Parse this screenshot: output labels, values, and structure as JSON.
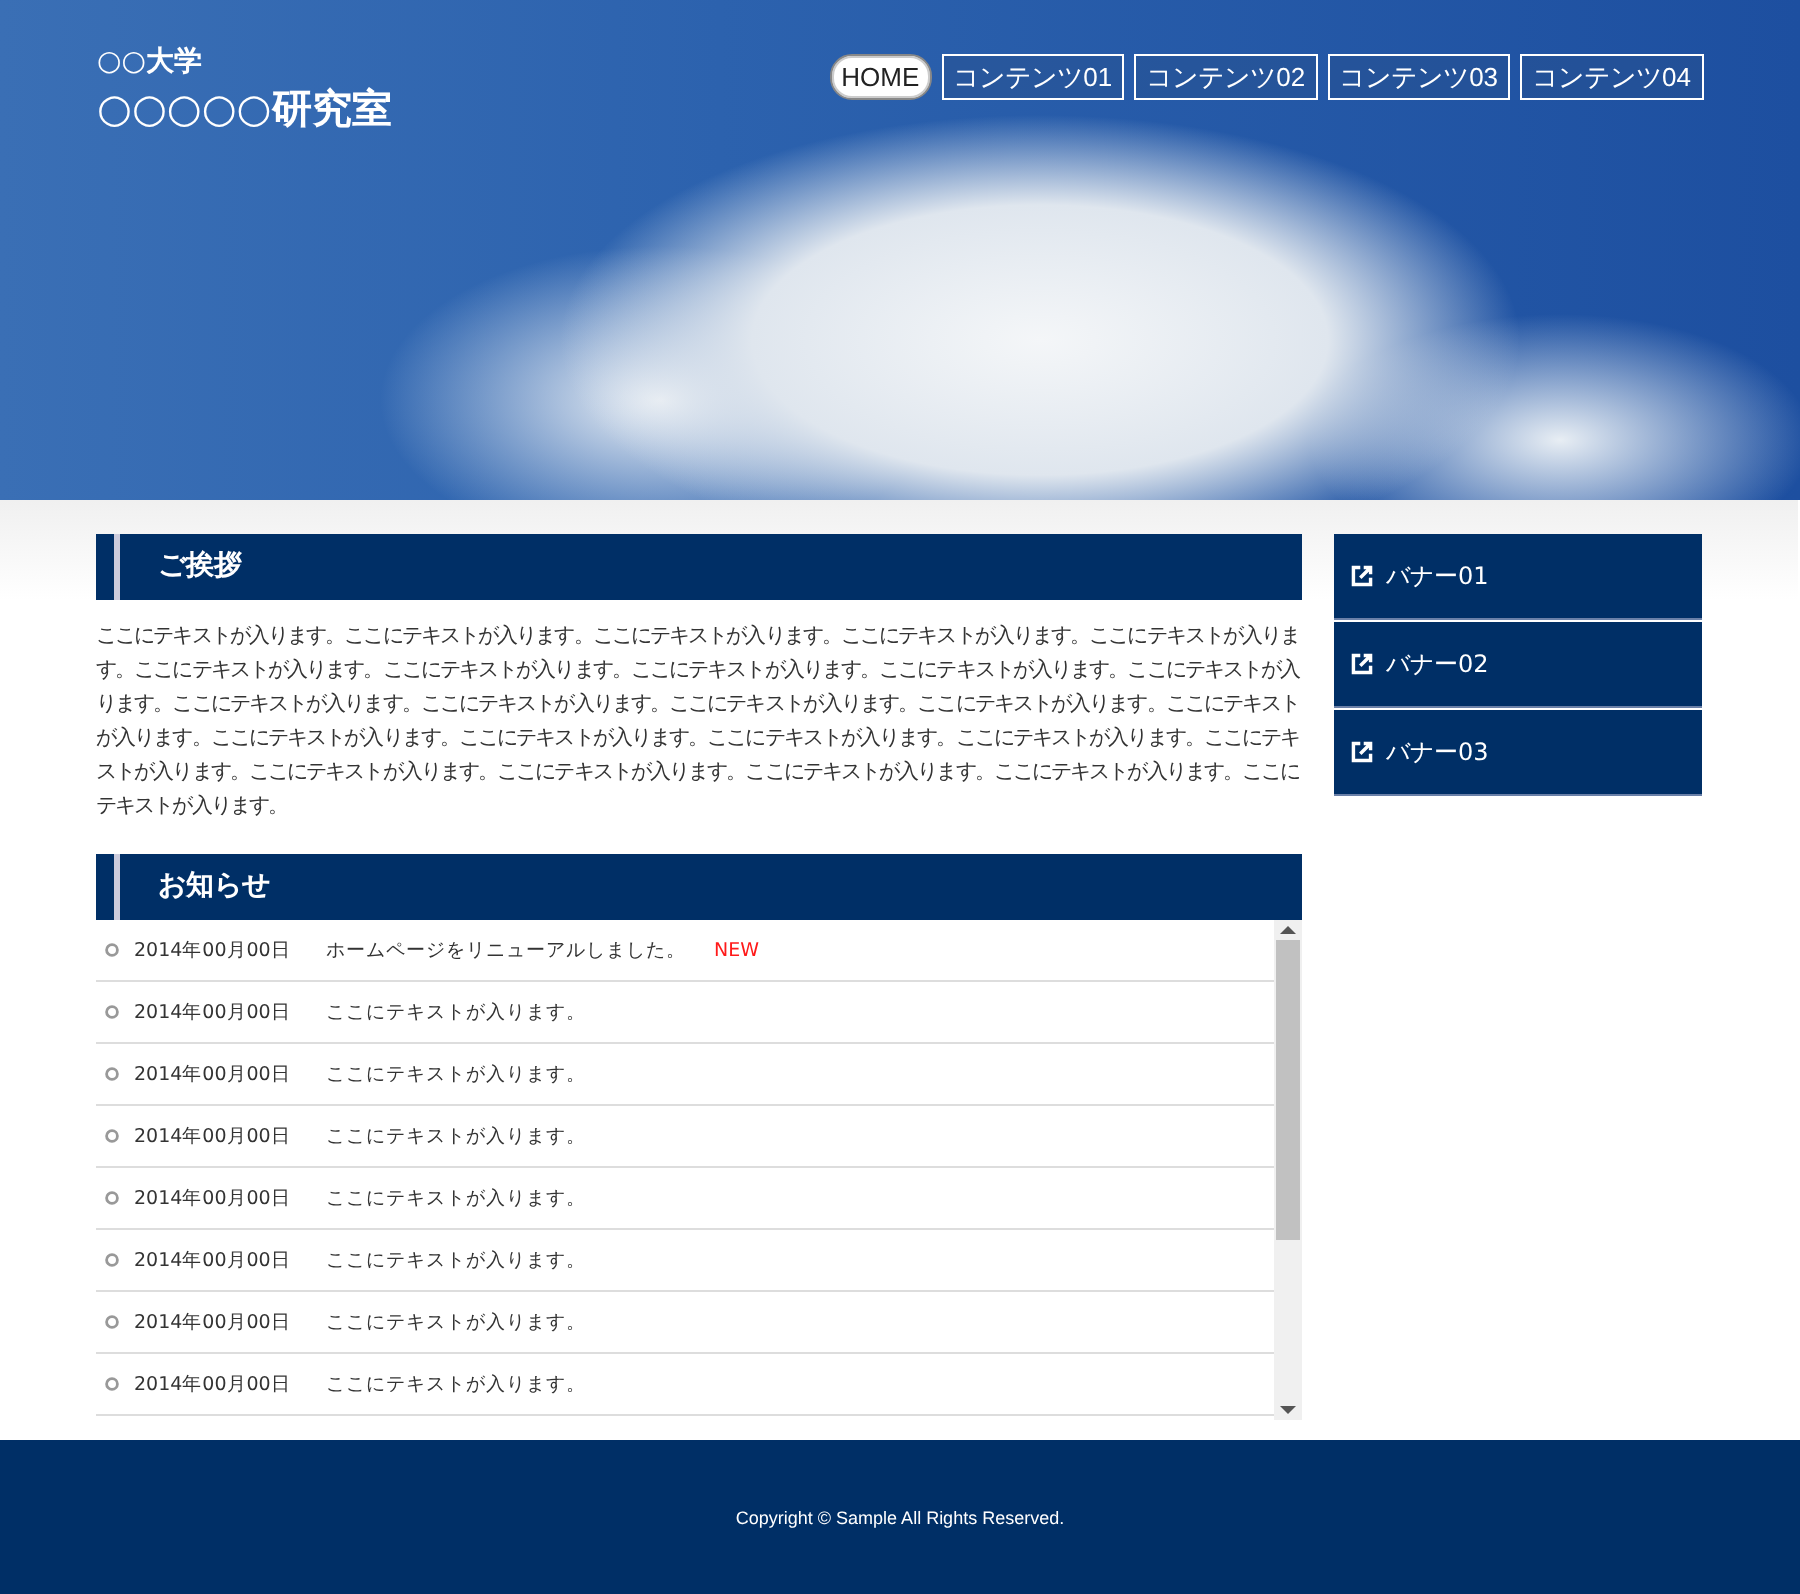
{
  "header": {
    "university": "○○大学",
    "lab": "○○○○○研究室",
    "nav": [
      {
        "label": "HOME",
        "selected": true
      },
      {
        "label": "コンテンツ01",
        "selected": false
      },
      {
        "label": "コンテンツ02",
        "selected": false
      },
      {
        "label": "コンテンツ03",
        "selected": false
      },
      {
        "label": "コンテンツ04",
        "selected": false
      }
    ]
  },
  "greeting": {
    "title": "ご挨拶",
    "body": "ここにテキストが入ります。ここにテキストが入ります。ここにテキストが入ります。ここにテキストが入ります。ここにテキストが入ります。ここにテキストが入ります。ここにテキストが入ります。ここにテキストが入ります。ここにテキストが入ります。ここにテキストが入ります。ここにテキストが入ります。ここにテキストが入ります。ここにテキストが入ります。ここにテキストが入ります。ここにテキストが入ります。ここにテキストが入ります。ここにテキストが入ります。ここにテキストが入ります。ここにテキストが入ります。ここにテキストが入ります。ここにテキストが入ります。ここにテキストが入ります。ここにテキストが入ります。ここにテキストが入ります。ここにテキストが入ります。"
  },
  "news": {
    "title": "お知らせ",
    "items": [
      {
        "date": "2014年00月00日",
        "text": "ホームページをリニューアルしました。",
        "badge": "NEW"
      },
      {
        "date": "2014年00月00日",
        "text": "ここにテキストが入ります。"
      },
      {
        "date": "2014年00月00日",
        "text": "ここにテキストが入ります。"
      },
      {
        "date": "2014年00月00日",
        "text": "ここにテキストが入ります。"
      },
      {
        "date": "2014年00月00日",
        "text": "ここにテキストが入ります。"
      },
      {
        "date": "2014年00月00日",
        "text": "ここにテキストが入ります。"
      },
      {
        "date": "2014年00月00日",
        "text": "ここにテキストが入ります。"
      },
      {
        "date": "2014年00月00日",
        "text": "ここにテキストが入ります。"
      }
    ]
  },
  "banners": [
    "バナー01",
    "バナー02",
    "バナー03"
  ],
  "footer": {
    "copyright": "Copyright © Sample All Rights Reserved."
  }
}
